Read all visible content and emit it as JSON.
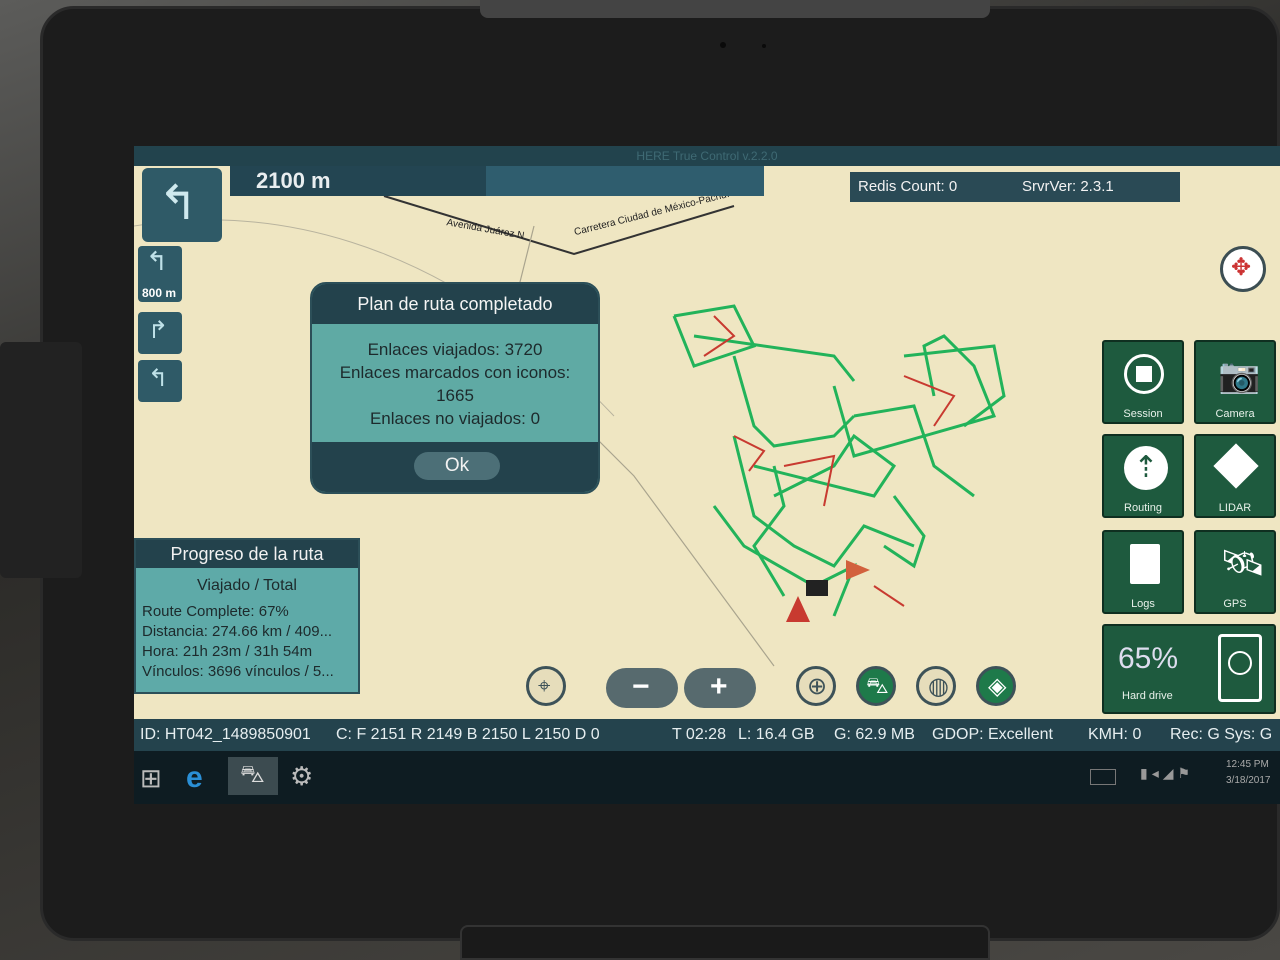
{
  "window_title": "HERE True Control v.2.2.0",
  "distance_banner": "2100 m",
  "next_turn_distance": "800 m",
  "redis_count": "Redis Count: 0",
  "server_version": "SrvrVer: 2.3.1",
  "map_labels": {
    "street1": "Avenida Juárez N",
    "street2": "Carretera Ciudad de México-Pachu..."
  },
  "dialog": {
    "title": "Plan de ruta completado",
    "line1": "Enlaces viajados: 3720",
    "line2": "Enlaces marcados con iconos:",
    "line3": "1665",
    "line4": "Enlaces no viajados: 0",
    "ok_label": "Ok"
  },
  "progress": {
    "title": "Progreso de la ruta",
    "subtitle": "Viajado / Total",
    "route_complete": "Route Complete: 67%",
    "distance": "Distancia: 274.66 km / 409...",
    "time": "Hora: 21h 23m / 31h 54m",
    "links": "Vínculos: 3696 vínculos / 5..."
  },
  "tiles": {
    "session": "Session",
    "camera": "Camera",
    "routing": "Routing",
    "lidar": "LIDAR",
    "logs": "Logs",
    "gps": "GPS",
    "hard_drive_pct": "65%",
    "hard_drive": "Hard drive"
  },
  "status": {
    "id": "ID: HT042_1489850901",
    "counts": "C: F 2151 R 2149 B 2150 L 2150 D 0",
    "time": "T 02:28",
    "disk": "L:  16.4 GB",
    "mem": "G:  62.9 MB",
    "gdop": "GDOP: Excellent",
    "kmh": "KMH: 0",
    "rec": "Rec: G  Sys: G"
  },
  "clock": {
    "time": "12:45 PM",
    "date": "3/18/2017"
  },
  "colors": {
    "map_bg": "#efe6c2",
    "route_green": "#22b35a",
    "route_red": "#c83a30",
    "panel_teal": "#5faaa4",
    "panel_dark": "#23424c"
  }
}
